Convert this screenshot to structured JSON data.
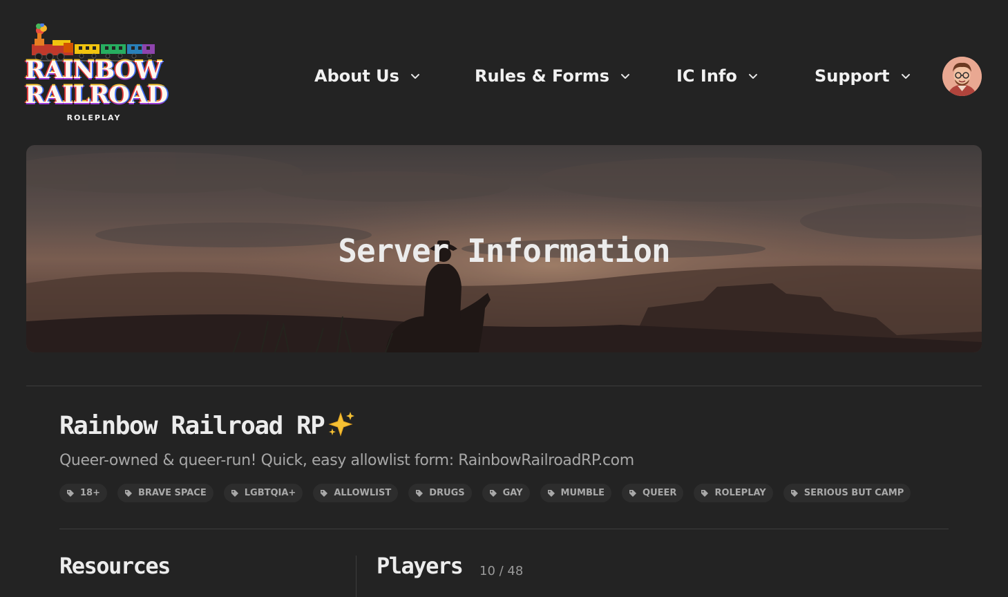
{
  "logo": {
    "line1": "RAINBOW",
    "line2": "RAILROAD",
    "subtitle": "ROLEPLAY"
  },
  "nav": {
    "items": [
      {
        "label": "About Us",
        "icon": "chevron-down-icon"
      },
      {
        "label": "Rules & Forms",
        "icon": "chevron-down-icon"
      },
      {
        "label": "IC Info",
        "icon": "chevron-down-icon"
      },
      {
        "label": "Support",
        "icon": "chevron-down-icon"
      }
    ]
  },
  "hero": {
    "title": "Server Information"
  },
  "server": {
    "name": "Rainbow Railroad RP",
    "name_emoji": "sparkles-icon",
    "description": "Queer-owned & queer-run! Quick, easy allowlist form: RainbowRailroadRP.com",
    "tags": [
      "18+",
      "BRAVE SPACE",
      "LGBTQIA+",
      "ALLOWLIST",
      "DRUGS",
      "GAY",
      "MUMBLE",
      "QUEER",
      "ROLEPLAY",
      "SERIOUS BUT CAMP"
    ]
  },
  "sections": {
    "resources_title": "Resources",
    "players_title": "Players",
    "players_count": "10 / 48"
  },
  "colors": {
    "background": "#232323",
    "text": "#ececec",
    "muted": "#a7a7a7",
    "tag_bg": "#2d2d2d",
    "divider": "#3d3d3d"
  }
}
